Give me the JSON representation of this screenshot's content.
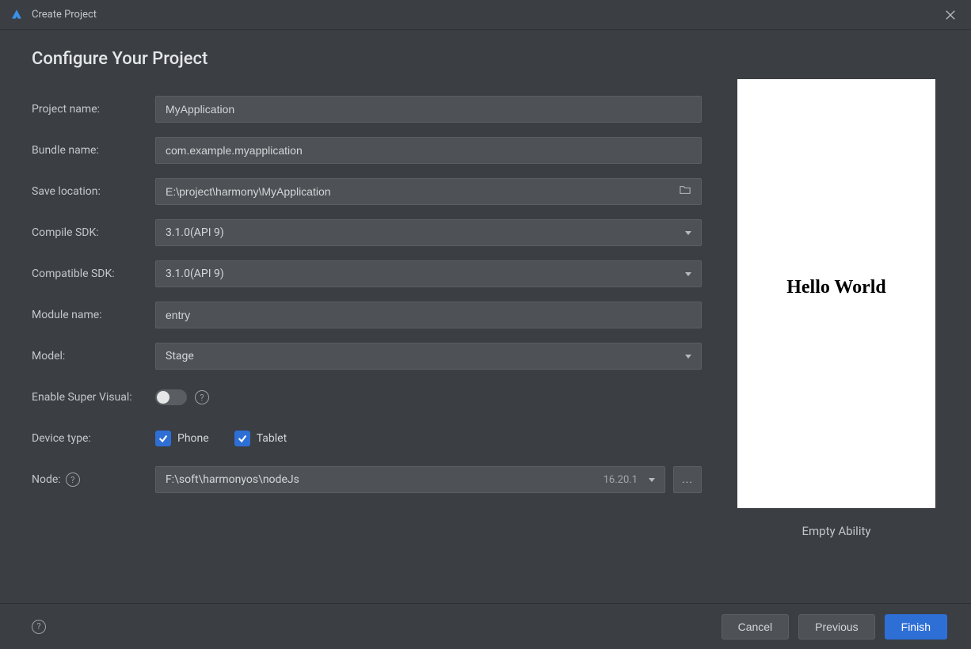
{
  "window": {
    "title": "Create Project"
  },
  "heading": "Configure Your Project",
  "fields": {
    "project_name": {
      "label": "Project name:",
      "value": "MyApplication"
    },
    "bundle_name": {
      "label": "Bundle name:",
      "value": "com.example.myapplication"
    },
    "save_location": {
      "label": "Save location:",
      "value": "E:\\project\\harmony\\MyApplication"
    },
    "compile_sdk": {
      "label": "Compile SDK:",
      "value": "3.1.0(API 9)"
    },
    "compatible_sdk": {
      "label": "Compatible SDK:",
      "value": "3.1.0(API 9)"
    },
    "module_name": {
      "label": "Module name:",
      "value": "entry"
    },
    "model": {
      "label": "Model:",
      "value": "Stage"
    },
    "super_visual": {
      "label": "Enable Super Visual:",
      "value": false
    },
    "device_type": {
      "label": "Device type:",
      "options": [
        {
          "label": "Phone",
          "checked": true
        },
        {
          "label": "Tablet",
          "checked": true
        }
      ]
    },
    "node": {
      "label": "Node:",
      "value": "F:\\soft\\harmonyos\\nodeJs",
      "version": "16.20.1"
    }
  },
  "preview": {
    "text": "Hello World",
    "caption": "Empty Ability"
  },
  "footer": {
    "cancel": "Cancel",
    "previous": "Previous",
    "finish": "Finish"
  },
  "browse_btn": "..."
}
